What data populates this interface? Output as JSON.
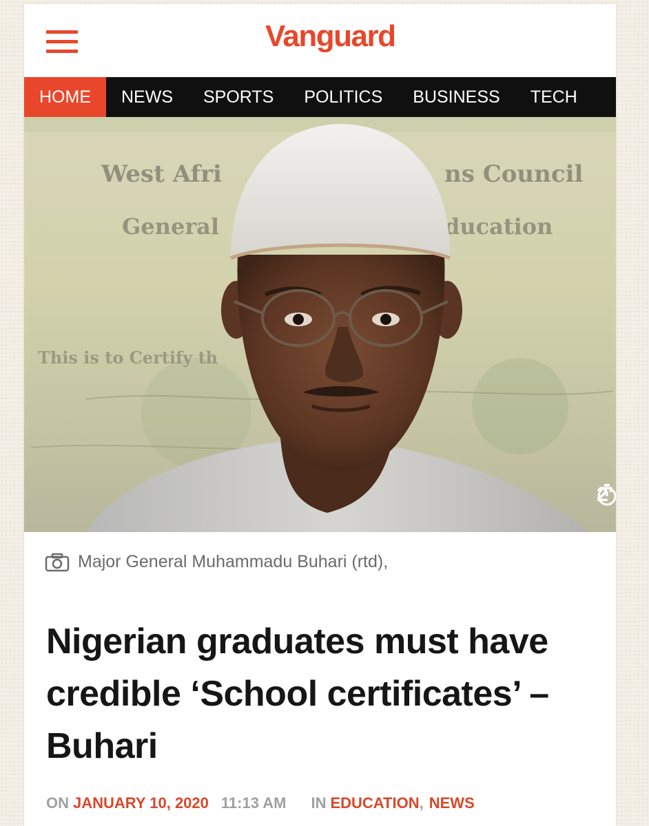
{
  "header": {
    "logo": "Vanguard",
    "menu_icon": "hamburger-menu-icon"
  },
  "nav": {
    "items": [
      {
        "label": "HOME",
        "active": true
      },
      {
        "label": "NEWS"
      },
      {
        "label": "SPORTS"
      },
      {
        "label": "POLITICS"
      },
      {
        "label": "BUSINESS"
      },
      {
        "label": "TECH"
      }
    ]
  },
  "hero": {
    "background_text": [
      "West Afri",
      "ns Council",
      "General",
      "ducation",
      "This is to Certify th"
    ],
    "read_time": "2'",
    "read_time_icon": "stopwatch-icon"
  },
  "caption": {
    "icon": "camera-icon",
    "text": "Major General Muhammadu Buhari (rtd),"
  },
  "article": {
    "headline": "Nigerian graduates must have credible ‘School certificates’ – Buhari",
    "on_label": "ON",
    "date": "JANUARY 10, 2020",
    "time": "11:13 AM",
    "in_label": "IN",
    "category_1": "EDUCATION",
    "separator": ",",
    "category_2": "NEWS"
  },
  "colors": {
    "accent": "#e8472b",
    "nav_bg": "#101010"
  }
}
